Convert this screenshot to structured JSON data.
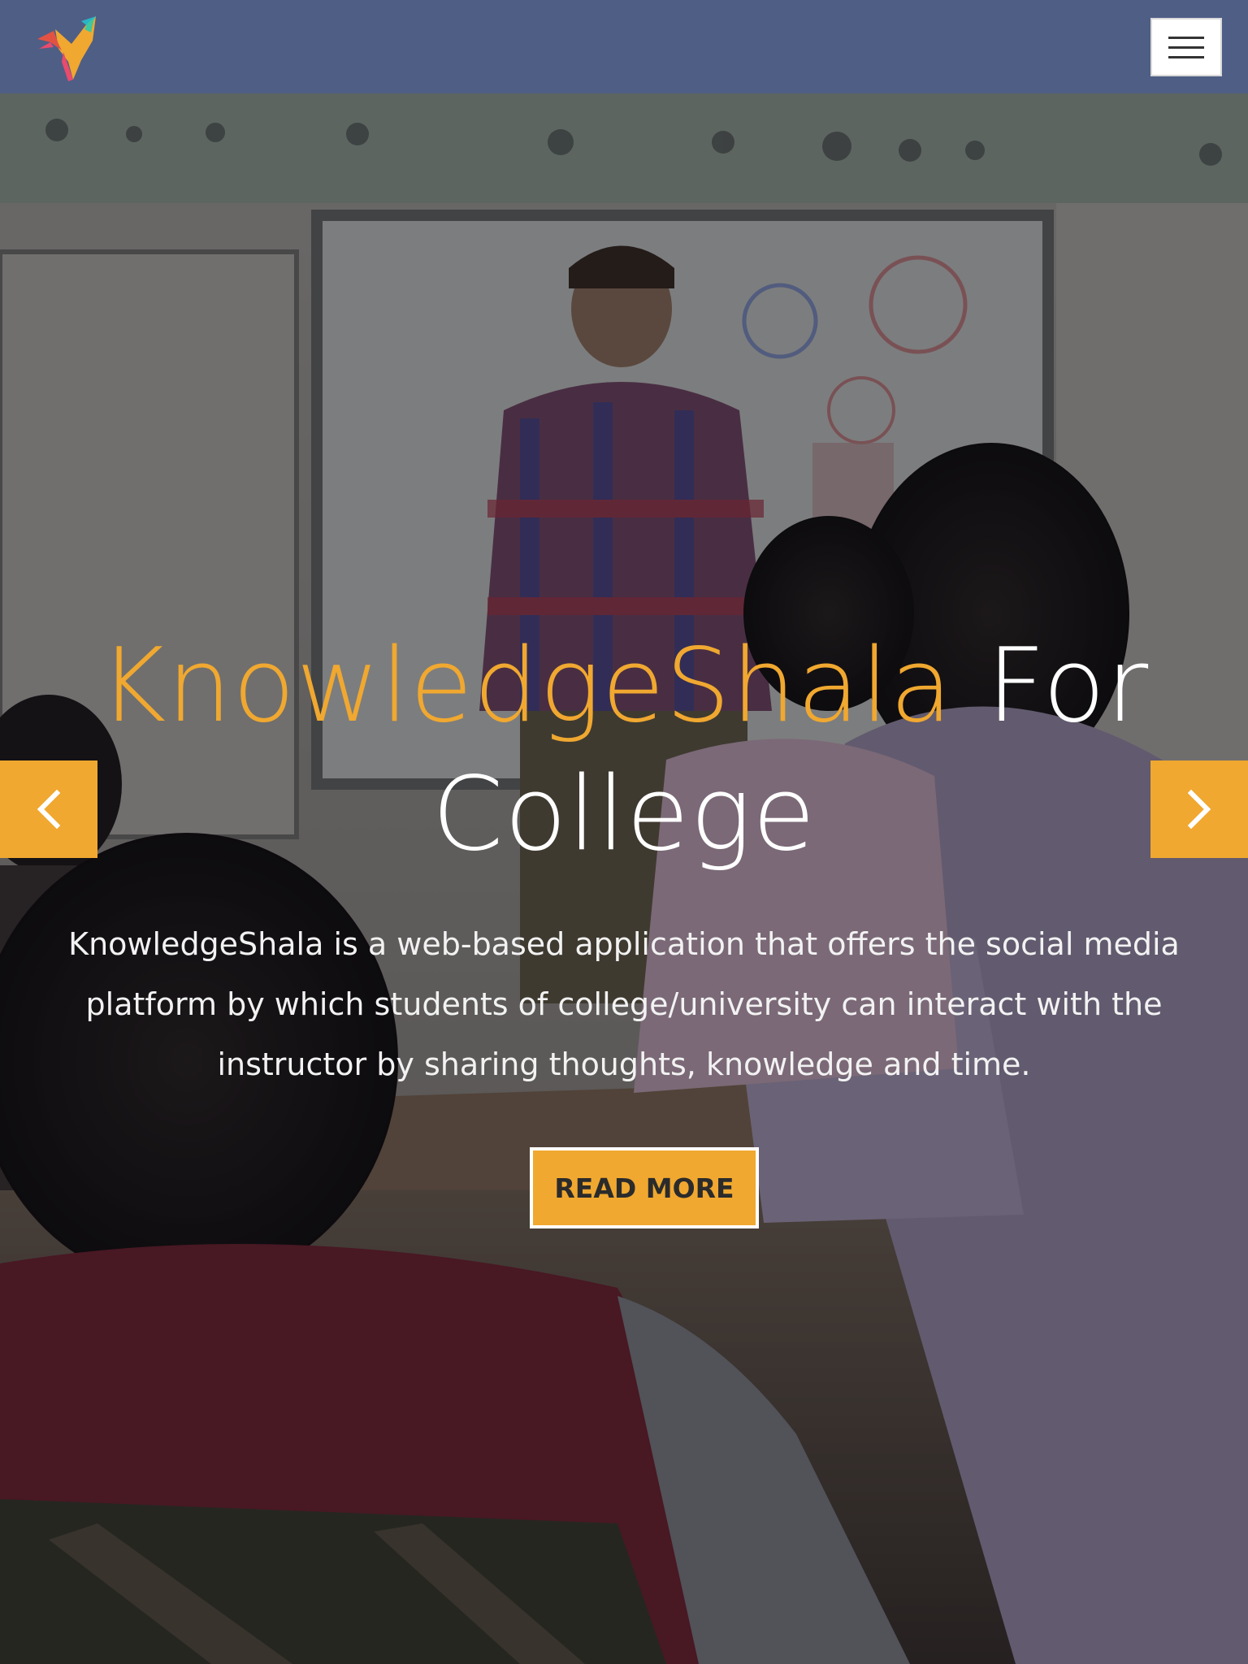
{
  "navbar": {
    "logo_icon": "knowledgeshala-book-bird-logo",
    "menu_icon": "hamburger-menu-icon",
    "background_color": "#4f5e85"
  },
  "hero": {
    "title_accent": "KnowledgeShala",
    "title_rest": " For College",
    "description": "KnowledgeShala is a web-based application that offers the social media platform by which students of college/university can interact with the instructor by sharing thoughts, knowledge and time.",
    "cta_label": "READ MORE",
    "accent_color": "#f0a830",
    "prev_icon": "chevron-left-icon",
    "next_icon": "chevron-right-icon"
  }
}
